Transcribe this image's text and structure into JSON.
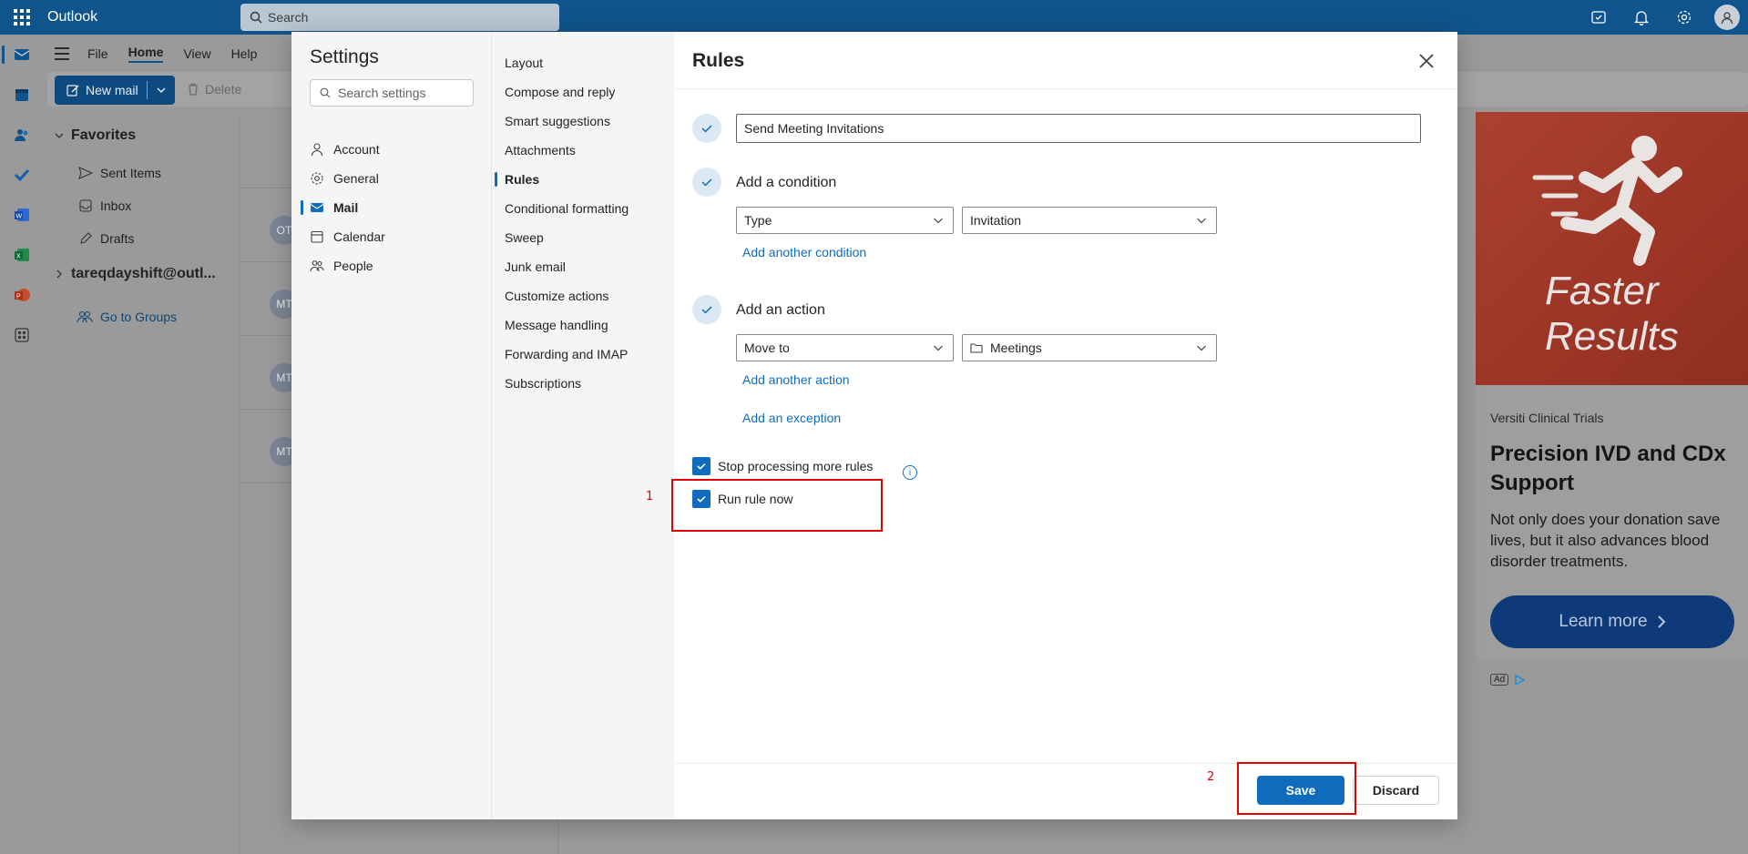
{
  "app": {
    "name": "Outlook",
    "search_placeholder": "Search"
  },
  "topbar_icons": [
    "my-day-icon",
    "bell-icon",
    "gear-icon",
    "avatar-icon"
  ],
  "rail_icons": [
    "mail-icon",
    "calendar-icon",
    "people-icon",
    "todo-icon",
    "word-icon",
    "excel-icon",
    "powerpoint-icon",
    "apps-icon"
  ],
  "ribbon": {
    "tabs": [
      "File",
      "Home",
      "View",
      "Help"
    ],
    "selected_tab": "Home",
    "new_mail_label": "New mail",
    "delete_label": "Delete"
  },
  "folders": {
    "favorites_label": "Favorites",
    "items": [
      "Sent Items",
      "Inbox",
      "Drafts"
    ],
    "account": "tareqdayshift@outl...",
    "groups_link": "Go to Groups"
  },
  "message_avatars": [
    "OT",
    "MT",
    "MT",
    "MT"
  ],
  "settings": {
    "title": "Settings",
    "search_placeholder": "Search settings",
    "categories": [
      {
        "label": "Account",
        "icon": "person-icon"
      },
      {
        "label": "General",
        "icon": "gear-icon"
      },
      {
        "label": "Mail",
        "icon": "mail-icon"
      },
      {
        "label": "Calendar",
        "icon": "calendar-icon"
      },
      {
        "label": "People",
        "icon": "people-icon"
      }
    ],
    "selected_category": "Mail",
    "mail_subsections": [
      "Layout",
      "Compose and reply",
      "Smart suggestions",
      "Attachments",
      "Rules",
      "Conditional formatting",
      "Sweep",
      "Junk email",
      "Customize actions",
      "Message handling",
      "Forwarding and IMAP",
      "Subscriptions"
    ],
    "selected_subsection": "Rules"
  },
  "rules": {
    "title": "Rules",
    "rule_name": "Send Meeting Invitations",
    "condition_heading": "Add a condition",
    "condition_type": "Type",
    "condition_value": "Invitation",
    "add_condition_link": "Add another condition",
    "action_heading": "Add an action",
    "action_type": "Move to",
    "action_folder": "Meetings",
    "add_action_link": "Add another action",
    "add_exception_link": "Add an exception",
    "stop_processing_label": "Stop processing more rules",
    "stop_processing_checked": true,
    "run_now_label": "Run rule now",
    "run_now_checked": true,
    "save_label": "Save",
    "discard_label": "Discard"
  },
  "ad": {
    "image_text_line1": "Faster",
    "image_text_line2": "Results",
    "sponsor": "Versiti Clinical Trials",
    "headline": "Precision IVD and CDx Support",
    "body": "Not only does your donation save lives, but it also advances blood disorder treatments.",
    "cta": "Learn more",
    "ad_label": "Ad"
  },
  "annotations": [
    "1",
    "2"
  ],
  "colors": {
    "brand": "#0f548c",
    "accent": "#0f6cbd",
    "annotation": "#e30000"
  }
}
